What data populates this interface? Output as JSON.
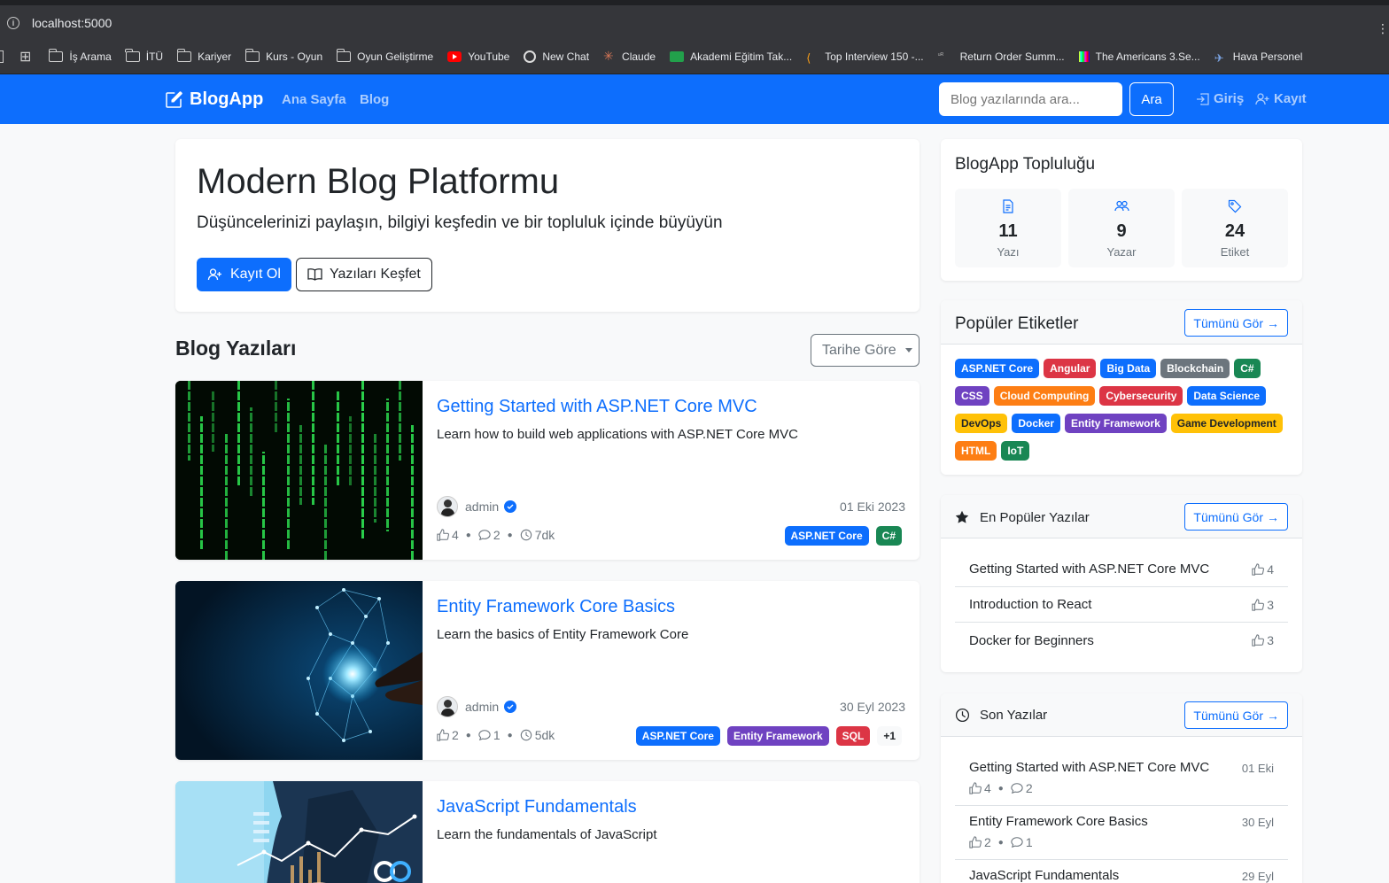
{
  "browser": {
    "url": "localhost:5000",
    "bookmarks": [
      "İş Arama",
      "İTÜ",
      "Kariyer",
      "Kurs - Oyun",
      "Oyun Geliştirme",
      "YouTube",
      "New Chat",
      "Claude",
      "Akademi Eğitim Tak...",
      "Top Interview 150 -...",
      "Return Order Summ...",
      "The Americans 3.Se...",
      "Hava Personel"
    ]
  },
  "navbar": {
    "brand": "BlogApp",
    "links": [
      "Ana Sayfa",
      "Blog"
    ],
    "search_placeholder": "Blog yazılarında ara...",
    "search_button": "Ara",
    "login": "Giriş",
    "register": "Kayıt"
  },
  "hero": {
    "title": "Modern Blog Platformu",
    "subtitle": "Düşüncelerinizi paylaşın, bilgiyi keşfedin ve bir topluluk içinde büyüyün",
    "register_button": "Kayıt Ol",
    "explore_button": "Yazıları Keşfet"
  },
  "posts_section": {
    "title": "Blog Yazıları",
    "sort": "Tarihe Göre",
    "posts": [
      {
        "title": "Getting Started with ASP.NET Core MVC",
        "excerpt": "Learn how to build web applications with ASP.NET Core MVC",
        "author": "admin",
        "date": "01 Eki 2023",
        "likes": "4",
        "comments": "2",
        "read_time": "7dk",
        "tags": [
          {
            "label": "ASP.NET Core",
            "color": "#0d6efd"
          },
          {
            "label": "C#",
            "color": "#198754"
          }
        ]
      },
      {
        "title": "Entity Framework Core Basics",
        "excerpt": "Learn the basics of Entity Framework Core",
        "author": "admin",
        "date": "30 Eyl 2023",
        "likes": "2",
        "comments": "1",
        "read_time": "5dk",
        "tags": [
          {
            "label": "ASP.NET Core",
            "color": "#0d6efd"
          },
          {
            "label": "Entity Framework",
            "color": "#6f42c1"
          },
          {
            "label": "SQL",
            "color": "#dc3545"
          },
          {
            "label": "+1",
            "color": "#f8f9fa"
          }
        ]
      },
      {
        "title": "JavaScript Fundamentals",
        "excerpt": "Learn the fundamentals of JavaScript"
      }
    ]
  },
  "community": {
    "title": "BlogApp Topluluğu",
    "stats": [
      {
        "value": "11",
        "label": "Yazı",
        "icon": "document-icon"
      },
      {
        "value": "9",
        "label": "Yazar",
        "icon": "people-icon"
      },
      {
        "value": "24",
        "label": "Etiket",
        "icon": "tag-icon"
      }
    ]
  },
  "popular_tags": {
    "title": "Popüler Etiketler",
    "see_all": "Tümünü Gör",
    "tags": [
      {
        "label": "ASP.NET Core",
        "color": "#0d6efd",
        "text": "#fff"
      },
      {
        "label": "Angular",
        "color": "#dc3545",
        "text": "#fff"
      },
      {
        "label": "Big Data",
        "color": "#0d6efd",
        "text": "#fff"
      },
      {
        "label": "Blockchain",
        "color": "#6c757d",
        "text": "#fff"
      },
      {
        "label": "C#",
        "color": "#198754",
        "text": "#fff"
      },
      {
        "label": "CSS",
        "color": "#6f42c1",
        "text": "#fff"
      },
      {
        "label": "Cloud Computing",
        "color": "#fd7e14",
        "text": "#fff"
      },
      {
        "label": "Cybersecurity",
        "color": "#dc3545",
        "text": "#fff"
      },
      {
        "label": "Data Science",
        "color": "#0d6efd",
        "text": "#fff"
      },
      {
        "label": "DevOps",
        "color": "#ffc107",
        "text": "#212529"
      },
      {
        "label": "Docker",
        "color": "#0d6efd",
        "text": "#fff"
      },
      {
        "label": "Entity Framework",
        "color": "#6f42c1",
        "text": "#fff"
      },
      {
        "label": "Game Development",
        "color": "#ffc107",
        "text": "#212529"
      },
      {
        "label": "HTML",
        "color": "#fd7e14",
        "text": "#fff"
      },
      {
        "label": "IoT",
        "color": "#198754",
        "text": "#fff"
      }
    ]
  },
  "popular_posts": {
    "title": "En Popüler Yazılar",
    "see_all": "Tümünü Gör",
    "items": [
      {
        "title": "Getting Started with ASP.NET Core MVC",
        "likes": "4"
      },
      {
        "title": "Introduction to React",
        "likes": "3"
      },
      {
        "title": "Docker for Beginners",
        "likes": "3"
      }
    ]
  },
  "recent_posts": {
    "title": "Son Yazılar",
    "see_all": "Tümünü Gör",
    "items": [
      {
        "title": "Getting Started with ASP.NET Core MVC",
        "date": "01 Eki",
        "likes": "4",
        "comments": "2"
      },
      {
        "title": "Entity Framework Core Basics",
        "date": "30 Eyl",
        "likes": "2",
        "comments": "1"
      },
      {
        "title": "JavaScript Fundamentals",
        "date": "29 Eyl"
      }
    ]
  }
}
